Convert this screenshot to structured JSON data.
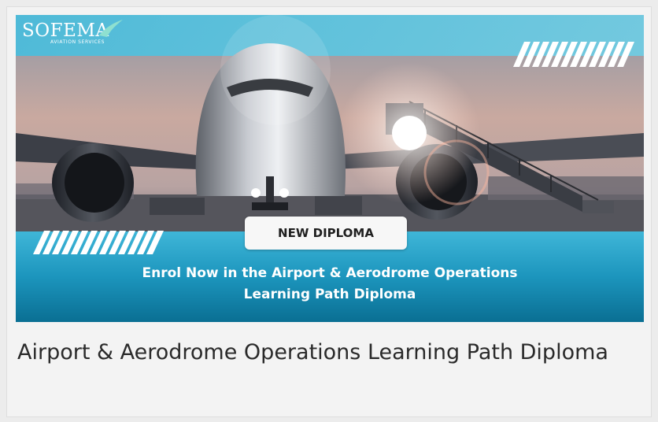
{
  "banner": {
    "logo_text": "SOFEMA",
    "logo_subtext": "AVIATION SERVICES",
    "badge_label": "NEW DIPLOMA",
    "headline_line1": "Enrol Now in the Airport & Aerodrome Operations",
    "headline_line2": "Learning Path Diploma"
  },
  "caption": {
    "title": "Airport & Aerodrome Operations Learning Path Diploma"
  },
  "colors": {
    "teal_top": "#5fc6e0",
    "teal_bottom": "#0a6f93",
    "accent_swoosh": "#7fd6c9",
    "caption_text": "#2a2a2a"
  }
}
